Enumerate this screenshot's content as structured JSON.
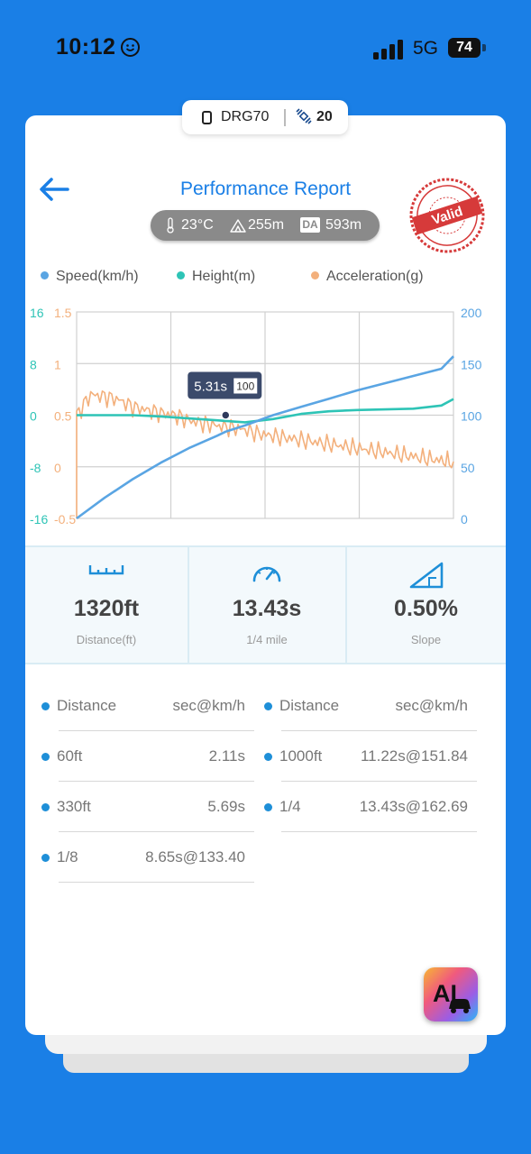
{
  "status_bar": {
    "time": "10:12",
    "network": "5G",
    "battery": "74"
  },
  "device": {
    "name": "DRG70",
    "satellites": "20"
  },
  "header": {
    "title": "Performance Report",
    "temperature": "23°C",
    "altitude": "255m",
    "da_label": "DA",
    "density_altitude": "593m",
    "stamp_text": "Valid"
  },
  "colors": {
    "speed": "#5aa5e3",
    "height": "#2ec4b6",
    "acceleration": "#f3b07c",
    "accent": "#1a7fe6"
  },
  "chart_data": {
    "type": "line",
    "x_range": [
      0,
      13.43
    ],
    "grid": true,
    "legend_position": "top",
    "series": [
      {
        "name": "Speed(km/h)",
        "axis": "right",
        "x": [
          0,
          1,
          2,
          3,
          4,
          5,
          5.31,
          6,
          7,
          8,
          9,
          10,
          11,
          12,
          13,
          13.43
        ],
        "y": [
          0,
          20,
          38,
          54,
          68,
          80,
          84,
          90,
          100,
          108,
          116,
          124,
          131,
          138,
          145,
          157
        ]
      },
      {
        "name": "Height(m)",
        "axis": "left",
        "x": [
          0,
          1,
          2,
          3,
          4,
          5,
          5.31,
          6,
          7,
          8,
          9,
          10,
          11,
          12,
          13,
          13.43
        ],
        "y": [
          0,
          0,
          0,
          -0.2,
          -0.5,
          -0.8,
          -0.9,
          -1.1,
          -0.6,
          0.2,
          0.6,
          0.8,
          0.9,
          1.0,
          1.5,
          2.5
        ]
      },
      {
        "name": "Acceleration(g)",
        "axis": "left2",
        "x": [
          0,
          0.5,
          1,
          1.5,
          2,
          2.5,
          3,
          3.5,
          4,
          4.5,
          5,
          5.5,
          6,
          6.5,
          7,
          7.5,
          8,
          8.5,
          9,
          9.5,
          10,
          10.5,
          11,
          11.5,
          12,
          12.5,
          13,
          13.43
        ],
        "y": [
          0.5,
          0.7,
          0.68,
          0.65,
          0.58,
          0.55,
          0.52,
          0.5,
          0.45,
          0.42,
          0.4,
          0.38,
          0.36,
          0.32,
          0.3,
          0.28,
          0.26,
          0.24,
          0.22,
          0.2,
          0.18,
          0.16,
          0.14,
          0.12,
          0.1,
          0.08,
          0.06,
          0.05
        ]
      }
    ],
    "axes": {
      "left_height": {
        "ticks": [
          "16",
          "8",
          "0",
          "-8",
          "-16"
        ],
        "range": [
          -16,
          16
        ]
      },
      "left_accel": {
        "ticks": [
          "1.5",
          "1",
          "0.5",
          "0",
          "-0.5"
        ],
        "range": [
          -0.5,
          1.5
        ]
      },
      "right_speed": {
        "ticks": [
          "200",
          "150",
          "100",
          "50",
          "0"
        ],
        "range": [
          0,
          200
        ]
      }
    },
    "tooltip": {
      "time": "5.31s",
      "speed": "100"
    }
  },
  "stats": [
    {
      "icon": "ruler-icon",
      "value": "1320ft",
      "label": "Distance(ft)"
    },
    {
      "icon": "speedometer-icon",
      "value": "13.43s",
      "label": "1/4 mile"
    },
    {
      "icon": "slope-icon",
      "value": "0.50%",
      "label": "Slope"
    }
  ],
  "table": {
    "header_left": {
      "key": "Distance",
      "value": "sec@km/h"
    },
    "header_right": {
      "key": "Distance",
      "value": "sec@km/h"
    },
    "left_rows": [
      {
        "key": "60ft",
        "value": "2.11s"
      },
      {
        "key": "330ft",
        "value": "5.69s"
      },
      {
        "key": "1/8",
        "value": "8.65s@133.40"
      }
    ],
    "right_rows": [
      {
        "key": "1000ft",
        "value": "11.22s@151.84"
      },
      {
        "key": "1/4",
        "value": "13.43s@162.69"
      }
    ]
  },
  "ai_button": {
    "label": "AI"
  }
}
